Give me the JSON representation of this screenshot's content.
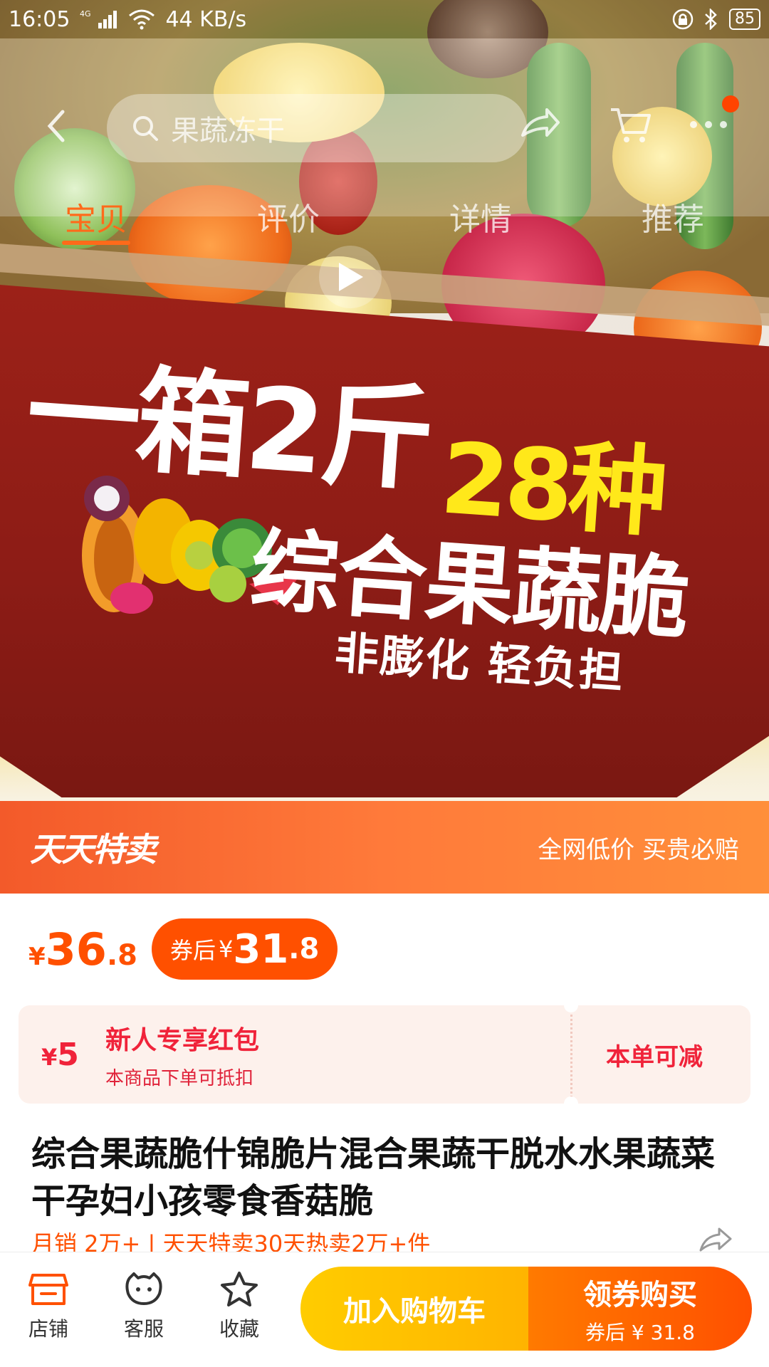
{
  "status_bar": {
    "time": "16:05",
    "network": "4G",
    "speed": "44 KB/s",
    "battery": "85"
  },
  "top_nav": {
    "search_placeholder": "果蔬冻干",
    "tabs": [
      {
        "label": "宝贝",
        "active": true
      },
      {
        "label": "评价",
        "active": false
      },
      {
        "label": "详情",
        "active": false
      },
      {
        "label": "推荐",
        "active": false
      }
    ]
  },
  "hero": {
    "line1": "一箱2斤",
    "line2": "28种",
    "line3": "综合果蔬脆",
    "line4": "非膨化 轻负担",
    "has_video": true
  },
  "promo_banner": {
    "logo": "天天特卖",
    "slogan": "全网低价 买贵必赔"
  },
  "price": {
    "symbol": "¥",
    "original_int": "36",
    "original_dec": ".8",
    "coupon_label": "券后",
    "coupon_symbol": "¥",
    "coupon_int": "31",
    "coupon_dec": ".8"
  },
  "red_packet": {
    "symbol": "¥",
    "amount": "5",
    "title": "新人专享红包",
    "subtitle": "本商品下单可抵扣",
    "action": "本单可减"
  },
  "product": {
    "title": "综合果蔬脆什锦脆片混合果蔬干脱水水果蔬菜干孕妇小孩零食香菇脆",
    "sales": "月销 2万+ | 天天特卖30天热卖2万+件"
  },
  "bottom_bar": {
    "shop": "店铺",
    "service": "客服",
    "favorite": "收藏",
    "add_to_cart": "加入购物车",
    "buy_main": "领券购买",
    "buy_sub": "券后 ¥ 31.8"
  },
  "colors": {
    "accent": "#ff5000",
    "red": "#f0233a",
    "yellow_btn": "#ffc200"
  }
}
